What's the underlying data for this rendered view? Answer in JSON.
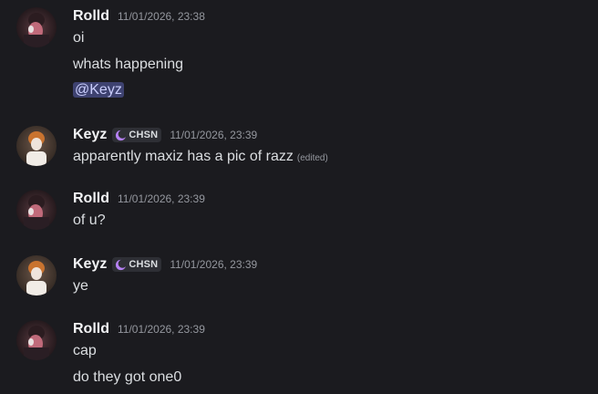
{
  "colors": {
    "background": "#1b1b1f",
    "username": "#f2f3f5",
    "text": "#dbdee1",
    "timestamp": "#94979e",
    "mention_bg": "#3e4270",
    "mention_text": "#c9cdfb",
    "tag_bg": "#2e2f35",
    "tag_icon": "#b681f5"
  },
  "messages": [
    {
      "author": "Rolld",
      "avatar_icon": "avatar-rolld",
      "timestamp": "11/01/2026, 23:38",
      "lines": [
        "oi",
        "whats happening"
      ],
      "mention": "@Keyz"
    },
    {
      "author": "Keyz",
      "avatar_icon": "avatar-keyz",
      "tag": "CHSN",
      "tag_icon": "moon-icon",
      "timestamp": "11/01/2026, 23:39",
      "lines": [
        "apparently maxiz has a pic of razz"
      ],
      "edited": "(edited)"
    },
    {
      "author": "Rolld",
      "avatar_icon": "avatar-rolld",
      "timestamp": "11/01/2026, 23:39",
      "lines": [
        "of u?"
      ]
    },
    {
      "author": "Keyz",
      "avatar_icon": "avatar-keyz",
      "tag": "CHSN",
      "tag_icon": "moon-icon",
      "timestamp": "11/01/2026, 23:39",
      "lines": [
        "ye"
      ]
    },
    {
      "author": "Rolld",
      "avatar_icon": "avatar-rolld",
      "timestamp": "11/01/2026, 23:39",
      "lines": [
        "cap",
        "do they got one0"
      ]
    }
  ]
}
